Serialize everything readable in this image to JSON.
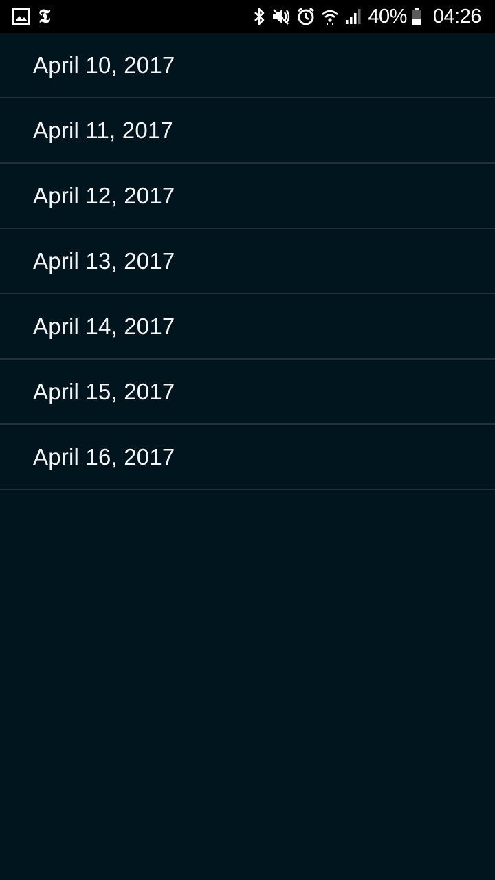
{
  "status_bar": {
    "left_icons": [
      "gallery-icon",
      "nytimes-icon"
    ],
    "nyt_glyph": "𝕿",
    "right_icons": [
      "bluetooth-icon",
      "mute-icon",
      "alarm-icon",
      "wifi-icon",
      "signal-icon"
    ],
    "battery_percent": "40%",
    "battery_level": 0.4,
    "time": "04:26"
  },
  "date_list": {
    "items": [
      {
        "label": "April 10, 2017"
      },
      {
        "label": "April 11, 2017"
      },
      {
        "label": "April 12, 2017"
      },
      {
        "label": "April 13, 2017"
      },
      {
        "label": "April 14, 2017"
      },
      {
        "label": "April 15, 2017"
      },
      {
        "label": "April 16, 2017"
      }
    ]
  },
  "colors": {
    "background": "#01151e",
    "status_bar": "#000000",
    "divider": "#1f323a",
    "text": "#f2f4f5"
  }
}
